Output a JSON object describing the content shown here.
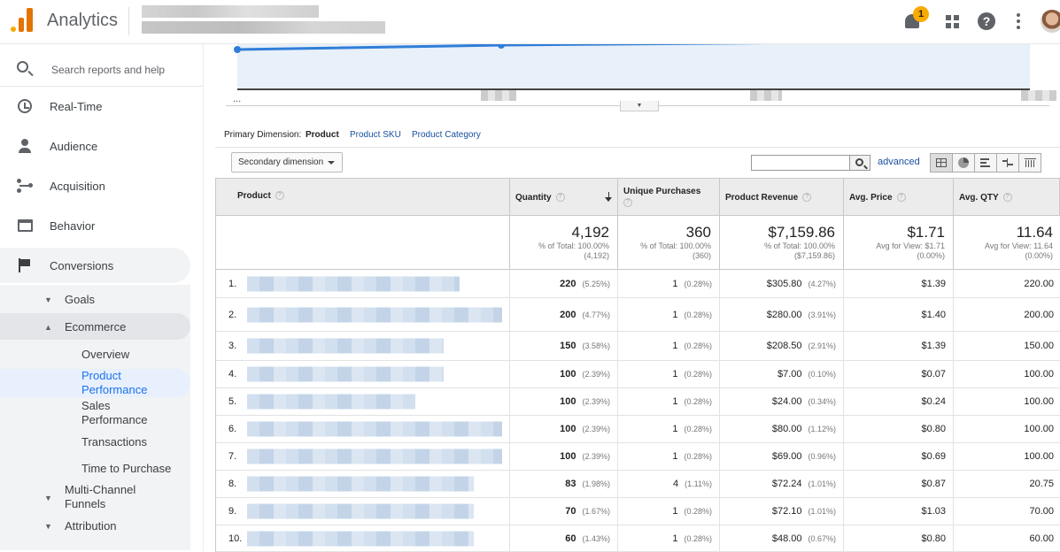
{
  "app": {
    "title": "Analytics",
    "badge_count": "1"
  },
  "colors": {
    "accent": "#1a73e8",
    "logo_orange": "#e37400",
    "logo_yellow": "#f9ab00",
    "link": "#1a4fa0"
  },
  "sidebar": {
    "search_placeholder": "Search reports and help",
    "items": [
      {
        "label": "Real-Time",
        "icon": "clock-icon"
      },
      {
        "label": "Audience",
        "icon": "person-icon"
      },
      {
        "label": "Acquisition",
        "icon": "acquisition-icon"
      },
      {
        "label": "Behavior",
        "icon": "behavior-icon"
      },
      {
        "label": "Conversions",
        "icon": "flag-icon"
      }
    ],
    "sub": {
      "goals": "Goals",
      "ecommerce": "Ecommerce",
      "overview": "Overview",
      "product_performance": "Product Performance",
      "sales_performance": "Sales Performance",
      "transactions": "Transactions",
      "time_to_purchase": "Time to Purchase",
      "multichannel": "Multi-Channel Funnels",
      "attribution": "Attribution"
    }
  },
  "chart": {
    "ellipsis": "..."
  },
  "dimension": {
    "label": "Primary Dimension:",
    "current": "Product",
    "options": [
      "Product SKU",
      "Product Category"
    ]
  },
  "toolbar": {
    "secondary": "Secondary dimension",
    "advanced": "advanced"
  },
  "table": {
    "columns": {
      "product": "Product",
      "quantity": "Quantity",
      "unique": "Unique Purchases",
      "revenue": "Product Revenue",
      "avg_price": "Avg. Price",
      "avg_qty": "Avg. QTY"
    },
    "totals": {
      "quantity": {
        "value": "4,192",
        "l1": "% of Total: 100.00%",
        "l2": "(4,192)"
      },
      "unique": {
        "value": "360",
        "l1": "% of Total: 100.00%",
        "l2": "(360)"
      },
      "revenue": {
        "value": "$7,159.86",
        "l1": "% of Total: 100.00%",
        "l2": "($7,159.86)"
      },
      "avg_price": {
        "value": "$1.71",
        "l1": "Avg for View: $1.71",
        "l2": "(0.00%)"
      },
      "avg_qty": {
        "value": "11.64",
        "l1": "Avg for View: 11.64",
        "l2": "(0.00%)"
      }
    },
    "rows": [
      {
        "n": "1.",
        "qty": "220",
        "qty_pct": "(5.25%)",
        "uniq": "1",
        "uniq_pct": "(0.28%)",
        "rev": "$305.80",
        "rev_pct": "(4.27%)",
        "price": "$1.39",
        "aqty": "220.00"
      },
      {
        "n": "2.",
        "qty": "200",
        "qty_pct": "(4.77%)",
        "uniq": "1",
        "uniq_pct": "(0.28%)",
        "rev": "$280.00",
        "rev_pct": "(3.91%)",
        "price": "$1.40",
        "aqty": "200.00"
      },
      {
        "n": "3.",
        "qty": "150",
        "qty_pct": "(3.58%)",
        "uniq": "1",
        "uniq_pct": "(0.28%)",
        "rev": "$208.50",
        "rev_pct": "(2.91%)",
        "price": "$1.39",
        "aqty": "150.00"
      },
      {
        "n": "4.",
        "qty": "100",
        "qty_pct": "(2.39%)",
        "uniq": "1",
        "uniq_pct": "(0.28%)",
        "rev": "$7.00",
        "rev_pct": "(0.10%)",
        "price": "$0.07",
        "aqty": "100.00"
      },
      {
        "n": "5.",
        "qty": "100",
        "qty_pct": "(2.39%)",
        "uniq": "1",
        "uniq_pct": "(0.28%)",
        "rev": "$24.00",
        "rev_pct": "(0.34%)",
        "price": "$0.24",
        "aqty": "100.00"
      },
      {
        "n": "6.",
        "qty": "100",
        "qty_pct": "(2.39%)",
        "uniq": "1",
        "uniq_pct": "(0.28%)",
        "rev": "$80.00",
        "rev_pct": "(1.12%)",
        "price": "$0.80",
        "aqty": "100.00"
      },
      {
        "n": "7.",
        "qty": "100",
        "qty_pct": "(2.39%)",
        "uniq": "1",
        "uniq_pct": "(0.28%)",
        "rev": "$69.00",
        "rev_pct": "(0.96%)",
        "price": "$0.69",
        "aqty": "100.00"
      },
      {
        "n": "8.",
        "qty": "83",
        "qty_pct": "(1.98%)",
        "uniq": "4",
        "uniq_pct": "(1.11%)",
        "rev": "$72.24",
        "rev_pct": "(1.01%)",
        "price": "$0.87",
        "aqty": "20.75"
      },
      {
        "n": "9.",
        "qty": "70",
        "qty_pct": "(1.67%)",
        "uniq": "1",
        "uniq_pct": "(0.28%)",
        "rev": "$72.10",
        "rev_pct": "(1.01%)",
        "price": "$1.03",
        "aqty": "70.00"
      },
      {
        "n": "10.",
        "qty": "60",
        "qty_pct": "(1.43%)",
        "uniq": "1",
        "uniq_pct": "(0.28%)",
        "rev": "$48.00",
        "rev_pct": "(0.67%)",
        "price": "$0.80",
        "aqty": "60.00"
      }
    ]
  }
}
